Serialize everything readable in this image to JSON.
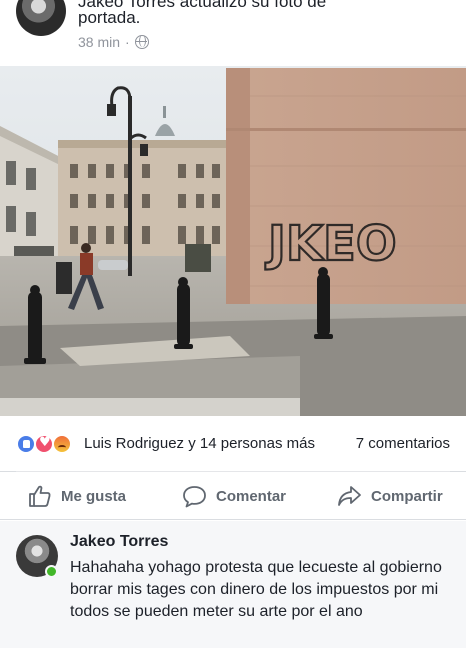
{
  "post": {
    "cut_text": "Jakeo Torres actualizó su foto de",
    "text": "portada.",
    "time": "38 min",
    "separator": "·",
    "privacy_icon": "globe-icon"
  },
  "photo": {
    "graffiti_tag": "JKEO"
  },
  "reactions": {
    "icons": [
      "like-icon",
      "love-icon",
      "angry-icon"
    ],
    "names": "Luis Rodriguez y 14 personas más",
    "comments": "7 comentarios"
  },
  "actions": {
    "like": "Me gusta",
    "comment": "Comentar",
    "share": "Compartir"
  },
  "comment": {
    "author": "Jakeo Torres",
    "text": "Hahahaha yohago protesta que lecueste al gobierno borrar mis tages con dinero de los impuestos por mi todos se pueden meter su arte por el ano"
  },
  "colors": {
    "text": "#1d2129",
    "meta": "#90949c",
    "action": "#606770",
    "like_blue": "#4a7de8",
    "love_red": "#f0506e",
    "online_green": "#42b72a"
  }
}
